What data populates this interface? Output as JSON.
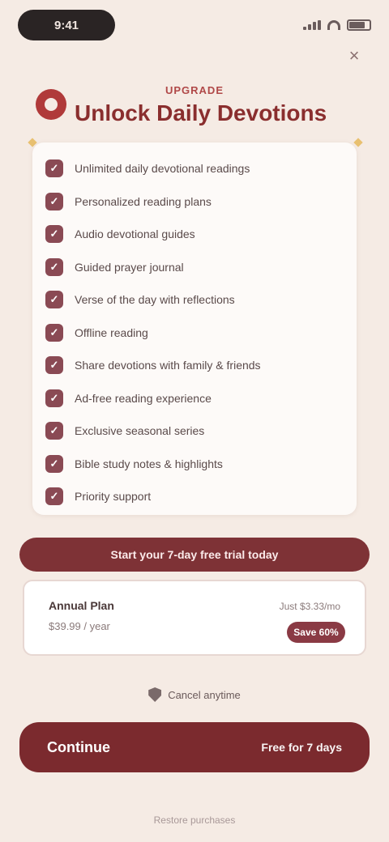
{
  "status": {
    "time": "9:41"
  },
  "header": {
    "kicker": "UPGRADE",
    "title": "Unlock Daily Devotions"
  },
  "features": [
    "Unlimited daily devotional readings",
    "Personalized reading plans",
    "Audio devotional guides",
    "Guided prayer journal",
    "Verse of the day with reflections",
    "Offline reading",
    "Share devotions with family & friends",
    "Ad-free reading experience",
    "Exclusive seasonal series",
    "Bible study notes & highlights",
    "Priority support"
  ],
  "banner": {
    "text": "Start your 7-day free trial today"
  },
  "plan": {
    "name": "Annual Plan",
    "price": "$39.99 / year",
    "sub": "Just $3.33/mo",
    "badge": "Save 60%"
  },
  "trust": {
    "text": "Cancel anytime"
  },
  "cta": {
    "label": "Continue",
    "side": "Free for 7 days"
  },
  "footer": {
    "text": "Restore purchases"
  }
}
